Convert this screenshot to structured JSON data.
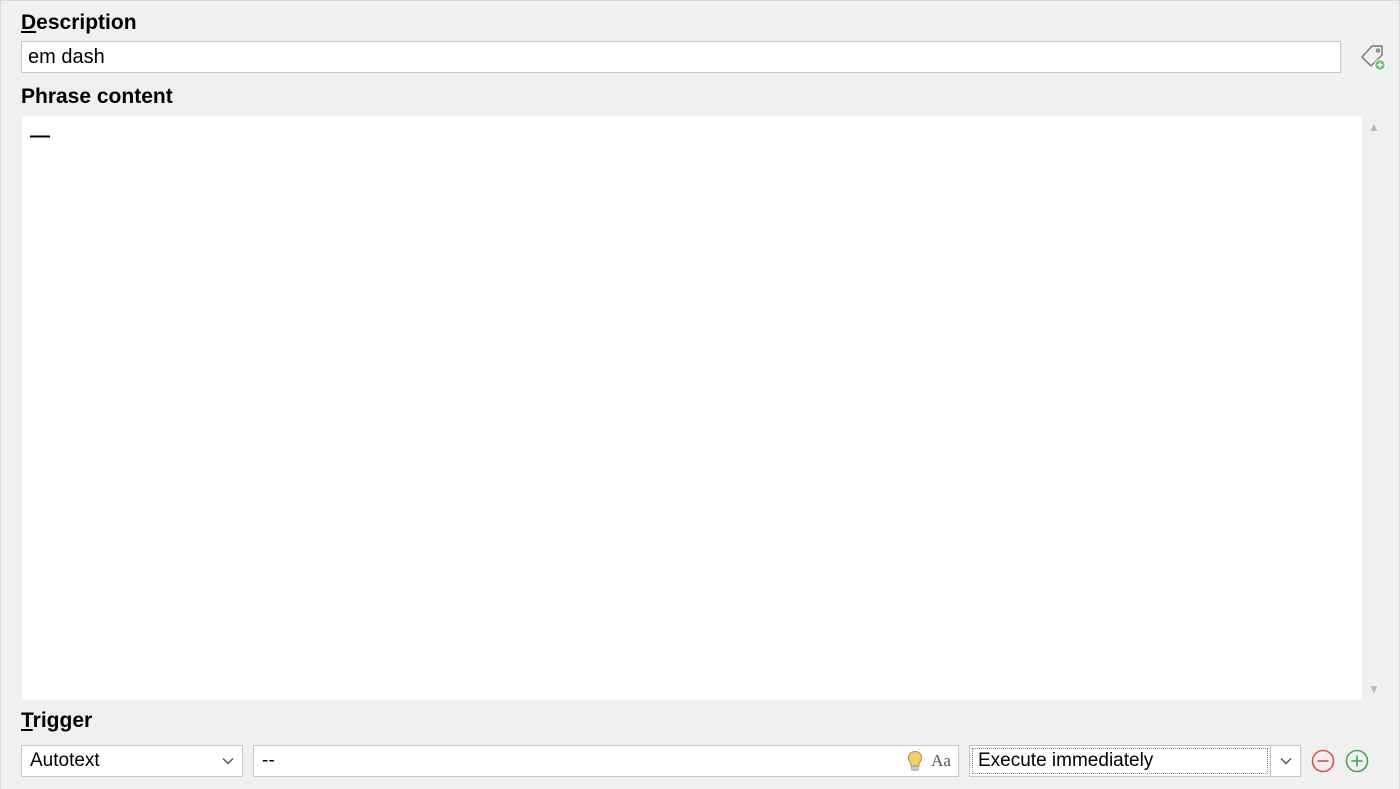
{
  "description": {
    "label_pre": "D",
    "label_rest": "escription",
    "value": "em dash"
  },
  "phrase": {
    "label": "Phrase content",
    "content": "—"
  },
  "trigger": {
    "label_pre": "T",
    "label_rest": "rigger",
    "type_selected": "Autotext",
    "text_value": "--",
    "exec_selected": "Execute immediately"
  },
  "icons": {
    "tag": "tag-add-icon",
    "hint": "hint-bulb-icon",
    "case": "case-sensitive-icon",
    "remove": "remove-trigger-icon",
    "add": "add-trigger-icon"
  }
}
